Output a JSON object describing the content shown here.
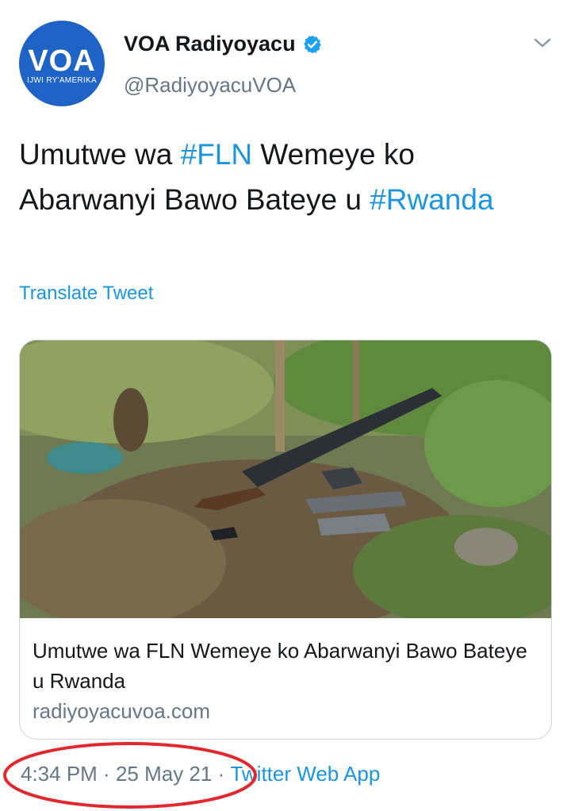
{
  "account": {
    "avatar_text": "VOA",
    "avatar_subtext": "IJWI RY'AMERIKA",
    "display_name": "VOA Radiyoyacu",
    "handle": "@RadiyoyacuVOA",
    "verified": true
  },
  "tweet": {
    "text_part1": "Umutwe wa ",
    "hashtag1": "#FLN",
    "text_part2": " Wemeye ko Abarwanyi Bawo Bateye u ",
    "hashtag2": "#Rwanda",
    "translate_label": "Translate Tweet"
  },
  "card": {
    "title": "Umutwe wa FLN Wemeye ko Abarwanyi Bawo Bateye u Rwanda",
    "domain": "radiyoyacuvoa.com"
  },
  "meta": {
    "time": "4:34 PM",
    "sep1": " · ",
    "date": "25 May 21",
    "sep2": " · ",
    "source": "Twitter Web App"
  },
  "colors": {
    "link": "#1b95e0",
    "secondary_text": "#657786",
    "annotation_circle": "#e0282e"
  },
  "icons": [
    "verified-badge-icon",
    "chevron-down-icon"
  ]
}
